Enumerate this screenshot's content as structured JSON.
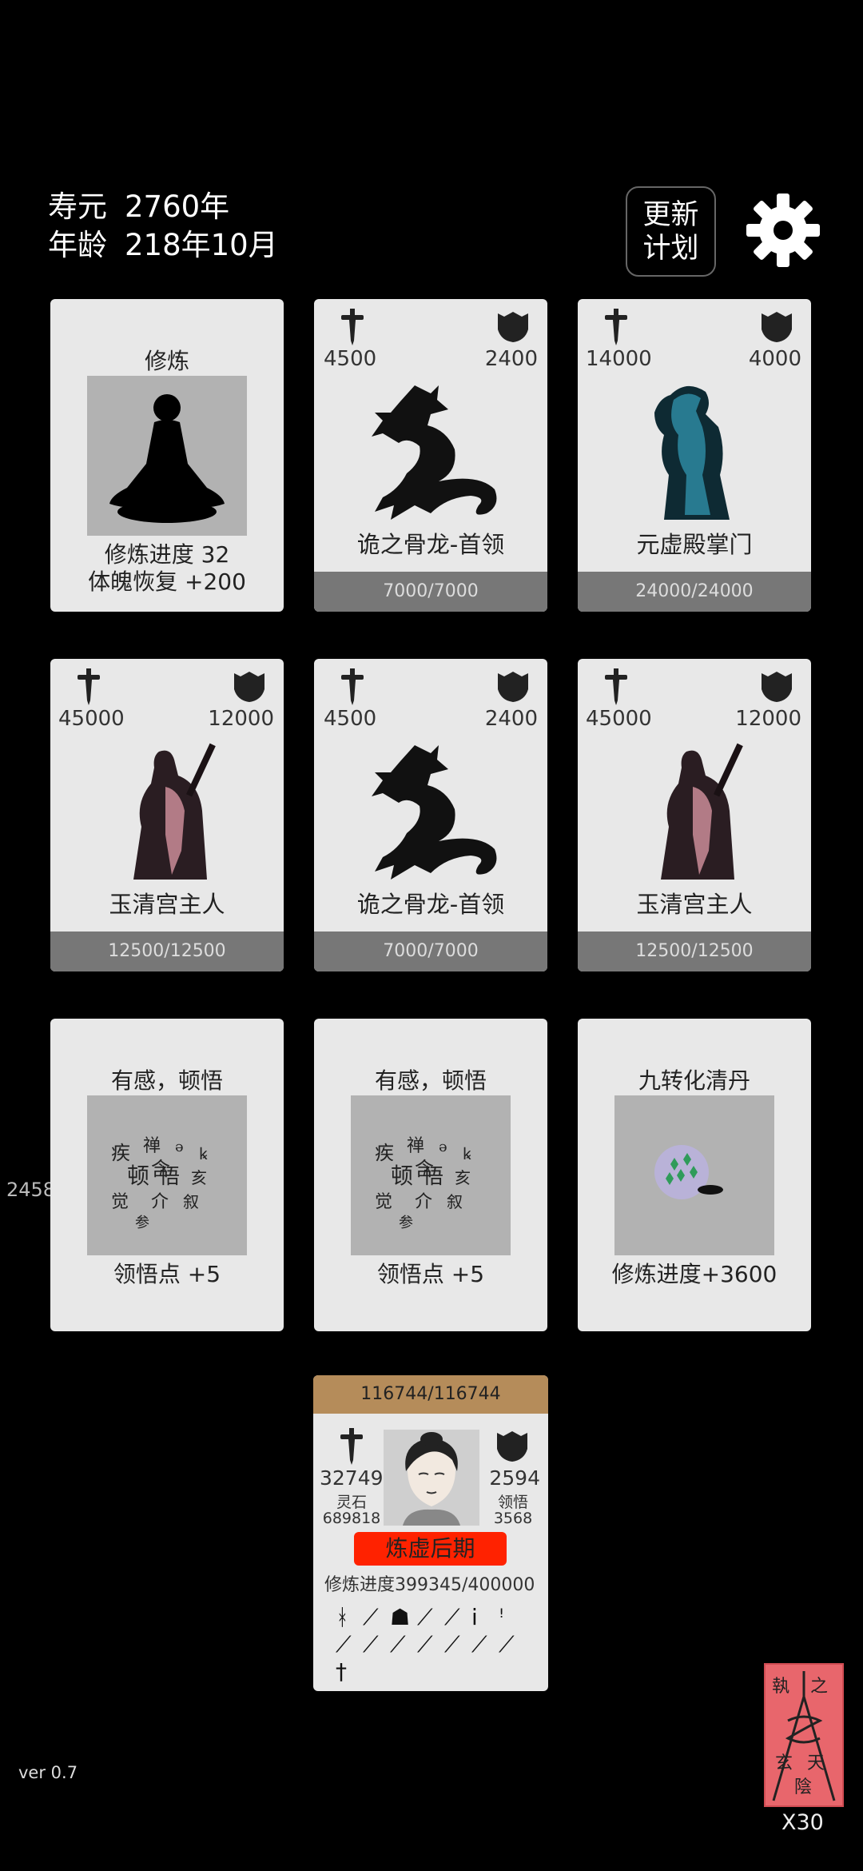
{
  "header": {
    "lifespan_label": "寿元",
    "lifespan_value": "2760年",
    "age_label": "年龄",
    "age_value": "218年10月",
    "refresh_line1": "更新",
    "refresh_line2": "计划",
    "settings_icon": "gear-icon"
  },
  "cards_row1": [
    {
      "type": "cultivate",
      "title": "修炼",
      "line1": "修炼进度  32",
      "line2": "体魄恢复  +200",
      "icon": "meditating-figure-icon"
    },
    {
      "type": "enemy",
      "atk": "4500",
      "def": "2400",
      "name": "诡之骨龙-首领",
      "hp": "7000/7000",
      "icon": "bone-dragon-icon"
    },
    {
      "type": "enemy",
      "atk": "14000",
      "def": "4000",
      "name": "元虚殿掌门",
      "hp": "24000/24000",
      "icon": "sect-master-icon"
    }
  ],
  "cards_row2": [
    {
      "type": "enemy",
      "atk": "45000",
      "def": "12000",
      "name": "玉清宫主人",
      "hp": "12500/12500",
      "icon": "palace-master-icon"
    },
    {
      "type": "enemy",
      "atk": "4500",
      "def": "2400",
      "name": "诡之骨龙-首领",
      "hp": "7000/7000",
      "icon": "bone-dragon-icon"
    },
    {
      "type": "enemy",
      "atk": "45000",
      "def": "12000",
      "name": "玉清宫主人",
      "hp": "12500/12500",
      "icon": "palace-master-icon"
    }
  ],
  "cards_row3": [
    {
      "type": "insight",
      "title": "有感，顿悟",
      "line1": "领悟点  +5",
      "icon": "calligraphy-insight-icon"
    },
    {
      "type": "insight",
      "title": "有感，顿悟",
      "line1": "领悟点  +5",
      "icon": "calligraphy-insight-icon"
    },
    {
      "type": "pill",
      "title": "九转化清丹",
      "line1": "修炼进度+3600",
      "icon": "pill-icon"
    }
  ],
  "side_number": "2458",
  "player": {
    "hp": "116744/116744",
    "atk": "32749",
    "def": "2594",
    "spirit_stone_label": "灵石",
    "spirit_stone": "689818",
    "insight_label": "领悟",
    "insight": "3568",
    "realm": "炼虚后期",
    "progress": "修炼进度399345/400000",
    "avatar_icon": "player-portrait-icon",
    "weapons": [
      "ᚼ",
      "⟋",
      "☗",
      "⟋",
      "⟋",
      "ⅰ",
      "ꜝ",
      "⟋",
      "⟋",
      "⟋",
      "⟋",
      "⟋",
      "⟋",
      "⟋",
      "†"
    ]
  },
  "footer": {
    "version": "ver 0.7",
    "multiplier": "X30",
    "seal_text_1": "執",
    "seal_text_2": "之",
    "seal_text_3": "玄",
    "seal_text_4": "天",
    "seal_text_5": "陰"
  },
  "colors": {
    "background": "#000000",
    "card": "#e8e8e8",
    "hpbar": "#777777",
    "realm": "#ff2200",
    "seal": "#e8666c"
  }
}
